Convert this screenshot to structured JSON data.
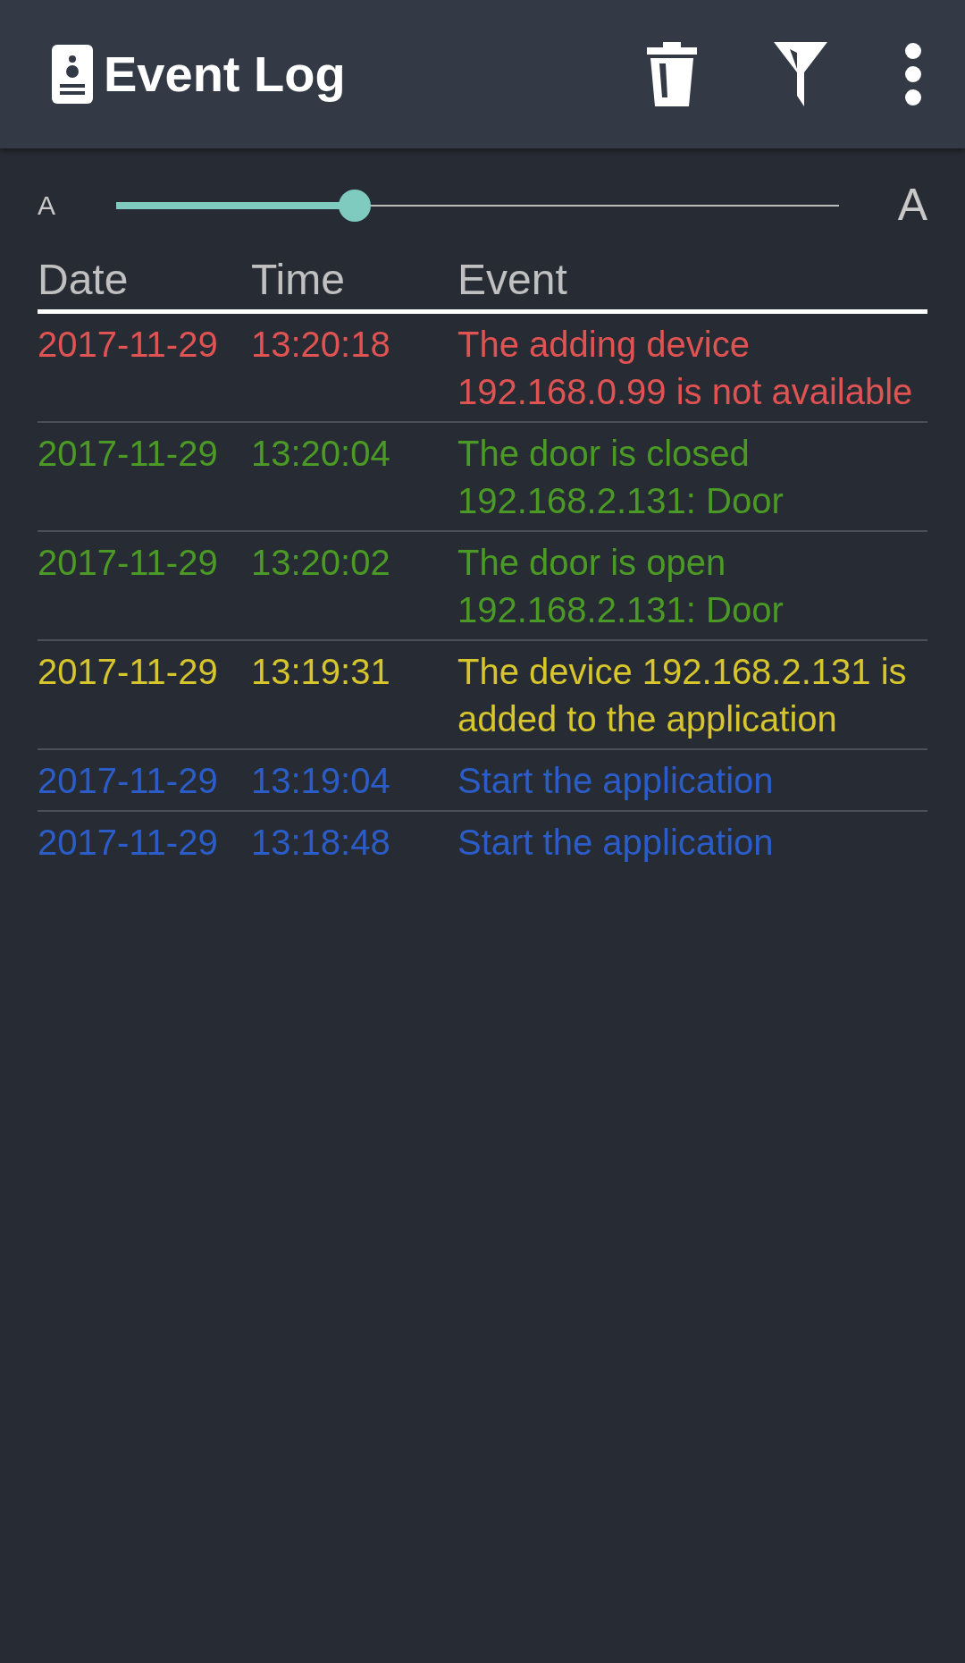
{
  "app_bar": {
    "title": "Event Log"
  },
  "font_slider": {
    "small_label": "A",
    "large_label": "A",
    "level": 0.33
  },
  "table": {
    "columns": [
      "Date",
      "Time",
      "Event"
    ],
    "rows": [
      {
        "date": "2017-11-29",
        "time": "13:20:18",
        "event": "The adding device 192.168.0.99 is not available",
        "color": "#e05353"
      },
      {
        "date": "2017-11-29",
        "time": "13:20:04",
        "event": "The door is closed 192.168.2.131: Door",
        "color": "#4b9a25"
      },
      {
        "date": "2017-11-29",
        "time": "13:20:02",
        "event": "The door is open 192.168.2.131: Door",
        "color": "#4b9a25"
      },
      {
        "date": "2017-11-29",
        "time": "13:19:31",
        "event": "The device 192.168.2.131 is added to the application",
        "color": "#d6c52d"
      },
      {
        "date": "2017-11-29",
        "time": "13:19:04",
        "event": "Start the application",
        "color": "#2b5dc9"
      },
      {
        "date": "2017-11-29",
        "time": "13:18:48",
        "event": "Start the application",
        "color": "#2b5dc9"
      }
    ]
  }
}
